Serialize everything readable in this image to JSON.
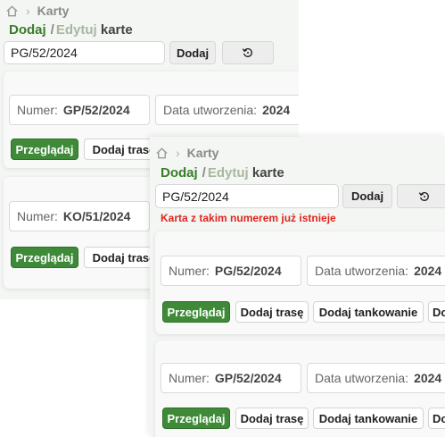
{
  "breadcrumb": {
    "current": "Karty"
  },
  "heading": {
    "add_tab": "Dodaj",
    "separator": "/",
    "edit_tab": "Edytuj",
    "suffix": "karte"
  },
  "form": {
    "number_value": "PG/52/2024",
    "add_button": "Dodaj"
  },
  "error_message": "Karta z takim numerem już istnieje",
  "labels": {
    "number": "Numer:",
    "created": "Data utworzenia:",
    "browse": "Przeglądaj",
    "add_route": "Dodaj trasę",
    "add_fuel": "Dodaj tankowanie",
    "more_truncated": "Do"
  },
  "back_cards": [
    {
      "number": "GP/52/2024",
      "created_partial": "2024"
    },
    {
      "number": "KO/51/2024"
    }
  ],
  "front_cards": [
    {
      "number": "PG/52/2024",
      "created_partial": "2024"
    },
    {
      "number": "GP/52/2024",
      "created_partial": "2024"
    }
  ],
  "icons": {
    "home": "home-icon",
    "chevron": "chevron-right-icon",
    "reset": "reset-icon"
  },
  "colors": {
    "primary_green": "#3e8a38",
    "error_red": "#e0261f",
    "edit_tab": "#a8b8a0"
  }
}
